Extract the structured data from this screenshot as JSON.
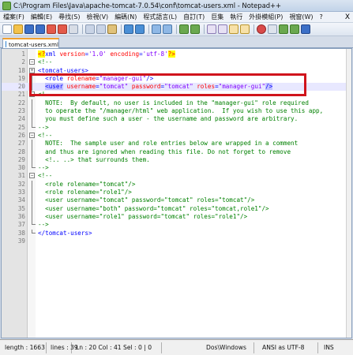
{
  "window": {
    "title": "C:\\Program Files\\Java\\apache-tomcat-7.0.54\\conf\\tomcat-users.xml - Notepad++",
    "menu": [
      "檔案(F)",
      "編輯(E)",
      "尋找(S)",
      "檢視(V)",
      "編碼(N)",
      "程式語言(L)",
      "自訂(T)",
      "巨集",
      "執行",
      "外掛模組(P)",
      "視窗(W)",
      "?"
    ],
    "menu_close": "X"
  },
  "tab": {
    "label": "tomcat-users.xml"
  },
  "editor": {
    "lines": [
      {
        "n": "1",
        "fold": "none",
        "segs": [
          [
            "pi",
            "<?"
          ],
          [
            "tag",
            "xml "
          ],
          [
            "attr",
            "version"
          ],
          [
            "tag",
            "="
          ],
          [
            "val",
            "'1.0'"
          ],
          [
            "tag",
            " "
          ],
          [
            "attr",
            "encoding"
          ],
          [
            "tag",
            "="
          ],
          [
            "val",
            "'utf-8'"
          ],
          [
            "pi",
            "?>"
          ]
        ]
      },
      {
        "n": "2",
        "fold": "minus",
        "segs": [
          [
            "comment",
            "<!--"
          ]
        ]
      },
      {
        "n": "18",
        "fold": "plus",
        "segs": [
          [
            "tag",
            "<tomcat-users>"
          ]
        ]
      },
      {
        "n": "19",
        "fold": "line",
        "segs": [
          [
            "tag",
            "  <role "
          ],
          [
            "attr",
            "rolename"
          ],
          [
            "tag",
            "="
          ],
          [
            "val",
            "\"manager-gui\""
          ],
          [
            "tag",
            "/>"
          ]
        ]
      },
      {
        "n": "20",
        "fold": "line",
        "segs": [
          [
            "tag",
            "  "
          ],
          [
            "hltag",
            "<user"
          ],
          [
            "tag",
            " "
          ],
          [
            "attr",
            "username"
          ],
          [
            "tag",
            "="
          ],
          [
            "val",
            "\"tomcat\""
          ],
          [
            "tag",
            " "
          ],
          [
            "attr",
            "password"
          ],
          [
            "tag",
            "="
          ],
          [
            "val",
            "\"tomcat\""
          ],
          [
            "tag",
            " "
          ],
          [
            "attr",
            "roles"
          ],
          [
            "tag",
            "="
          ],
          [
            "val",
            "\"manager-gui\""
          ],
          [
            "hltag",
            "/>"
          ]
        ]
      },
      {
        "n": "21",
        "fold": "minus",
        "segs": [
          [
            "comment",
            "<!--"
          ]
        ]
      },
      {
        "n": "22",
        "fold": "line",
        "segs": [
          [
            "comment",
            "  NOTE:  By default, no user is included in the \"manager-gui\" role required"
          ]
        ]
      },
      {
        "n": "23",
        "fold": "line",
        "segs": [
          [
            "comment",
            "  to operate the \"/manager/html\" web application.  If you wish to use this app,"
          ]
        ]
      },
      {
        "n": "24",
        "fold": "line",
        "segs": [
          [
            "comment",
            "  you must define such a user - the username and password are arbitrary."
          ]
        ]
      },
      {
        "n": "25",
        "fold": "end",
        "segs": [
          [
            "comment",
            "-->"
          ]
        ]
      },
      {
        "n": "26",
        "fold": "minus",
        "segs": [
          [
            "comment",
            "<!--"
          ]
        ]
      },
      {
        "n": "27",
        "fold": "line",
        "segs": [
          [
            "comment",
            "  NOTE:  The sample user and role entries below are wrapped in a comment"
          ]
        ]
      },
      {
        "n": "28",
        "fold": "line",
        "segs": [
          [
            "comment",
            "  and thus are ignored when reading this file. Do not forget to remove"
          ]
        ]
      },
      {
        "n": "29",
        "fold": "line",
        "segs": [
          [
            "comment",
            "  <!.. ..> that surrounds them."
          ]
        ]
      },
      {
        "n": "30",
        "fold": "end",
        "segs": [
          [
            "comment",
            "-->"
          ]
        ]
      },
      {
        "n": "31",
        "fold": "minus",
        "segs": [
          [
            "comment",
            "<!--"
          ]
        ]
      },
      {
        "n": "32",
        "fold": "line",
        "segs": [
          [
            "comment",
            "  <role rolename=\"tomcat\"/>"
          ]
        ]
      },
      {
        "n": "33",
        "fold": "line",
        "segs": [
          [
            "comment",
            "  <role rolename=\"role1\"/>"
          ]
        ]
      },
      {
        "n": "34",
        "fold": "line",
        "segs": [
          [
            "comment",
            "  <user username=\"tomcat\" password=\"tomcat\" roles=\"tomcat\"/>"
          ]
        ]
      },
      {
        "n": "35",
        "fold": "line",
        "segs": [
          [
            "comment",
            "  <user username=\"both\" password=\"tomcat\" roles=\"tomcat,role1\"/>"
          ]
        ]
      },
      {
        "n": "36",
        "fold": "line",
        "segs": [
          [
            "comment",
            "  <user username=\"role1\" password=\"tomcat\" roles=\"role1\"/>"
          ]
        ]
      },
      {
        "n": "37",
        "fold": "end",
        "segs": [
          [
            "comment",
            "-->"
          ]
        ]
      },
      {
        "n": "38",
        "fold": "end",
        "segs": [
          [
            "tag",
            "</tomcat-users>"
          ]
        ]
      },
      {
        "n": "39",
        "fold": "none",
        "segs": []
      }
    ]
  },
  "status": {
    "length": "length : 1663",
    "lines": "lines : 39",
    "position": "Ln : 20   Col : 41   Sel : 0 | 0",
    "eol": "Dos\\Windows",
    "encoding": "ANSI as UTF-8",
    "mode": "INS"
  },
  "colors": {
    "highlight_box": "#d0141c",
    "tag": "#0000ff",
    "attr": "#ff0000",
    "value": "#8000ff",
    "comment": "#008000"
  }
}
